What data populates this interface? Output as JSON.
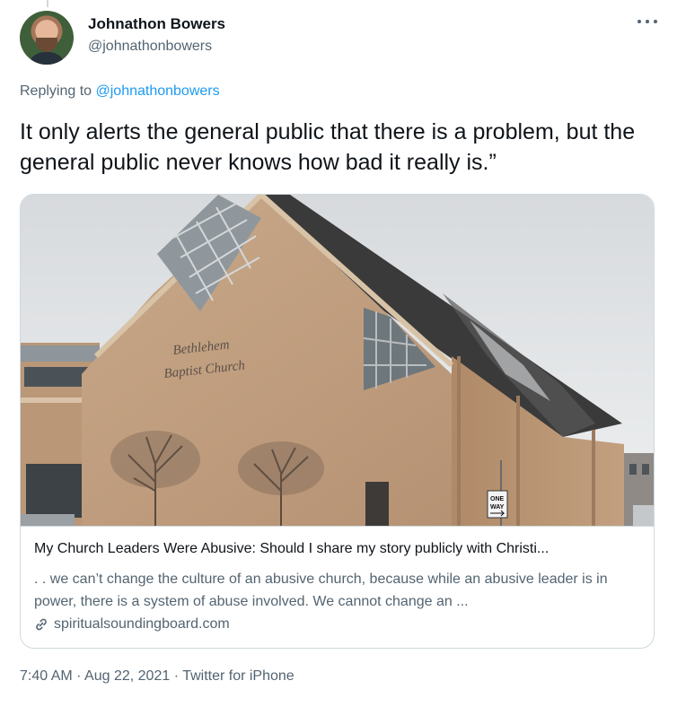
{
  "author": {
    "name": "Johnathon Bowers",
    "handle": "@johnathonbowers"
  },
  "reply": {
    "prefix": "Replying to",
    "mention": "@johnathonbowers"
  },
  "tweet": {
    "text": "It only alerts the general public that there is a problem, but the general public never knows how bad it really is.”"
  },
  "card": {
    "image_sign_line1": "Bethlehem",
    "image_sign_line2": "Baptist Church",
    "image_road_sign_line1": "ONE",
    "image_road_sign_line2": "WAY",
    "title": "My Church Leaders Were Abusive: Should I share my story publicly with Christi...",
    "description": ". . we can’t change the culture of an abusive church, because while an abusive leader is in power, there is a system of abuse involved. We cannot change an ...",
    "domain": "spiritualsoundingboard.com",
    "domain_icon": "link-icon"
  },
  "meta": {
    "time": "7:40 AM",
    "date": "Aug 22, 2021",
    "source": "Twitter for iPhone",
    "separator": "·"
  },
  "icons": {
    "more": "more-options-icon"
  },
  "colors": {
    "link": "#1d9bf0",
    "secondary_text": "#536471",
    "border": "#cfd9de"
  }
}
